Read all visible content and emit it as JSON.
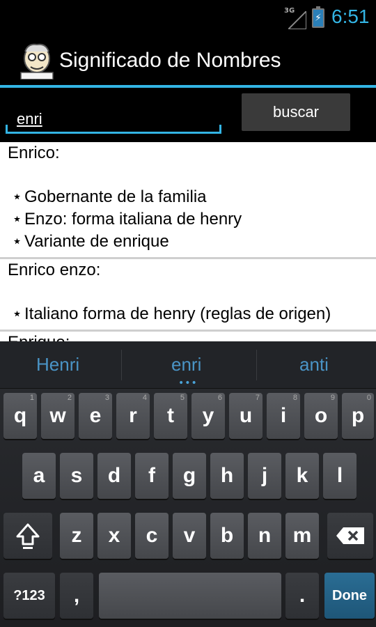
{
  "status": {
    "network": "3G",
    "time": "6:51"
  },
  "app": {
    "title": "Significado de Nombres",
    "icon": "cartoon-face-icon"
  },
  "search": {
    "value": "enri",
    "button_label": "buscar"
  },
  "results": [
    {
      "name": "Enrico:",
      "definitions": [
        "Gobernante de la familia",
        "Enzo: forma italiana de henry",
        "Variante de enrique"
      ]
    },
    {
      "name": "Enrico enzo:",
      "definitions": [
        "Italiano forma de henry (reglas de origen)"
      ]
    },
    {
      "name": "Enrique:",
      "definitions": []
    }
  ],
  "bullet": "⋆",
  "keyboard": {
    "suggestions": [
      "Henri",
      "enri",
      "anti"
    ],
    "row1": [
      "q",
      "w",
      "e",
      "r",
      "t",
      "y",
      "u",
      "i",
      "o",
      "p"
    ],
    "row1_nums": [
      "1",
      "2",
      "3",
      "4",
      "5",
      "6",
      "7",
      "8",
      "9",
      "0"
    ],
    "row2": [
      "a",
      "s",
      "d",
      "f",
      "g",
      "h",
      "j",
      "k",
      "l"
    ],
    "row3": [
      "z",
      "x",
      "c",
      "v",
      "b",
      "n",
      "m"
    ],
    "symbols_key": "?123",
    "comma_key": ",",
    "period_key": ".",
    "done_key": "Done",
    "shift_icon": "shift-arrow-icon",
    "backspace_icon": "backspace-icon"
  },
  "colors": {
    "accent": "#33b5e5",
    "suggestion": "#4a94c6",
    "done_key": "#1e5678"
  }
}
